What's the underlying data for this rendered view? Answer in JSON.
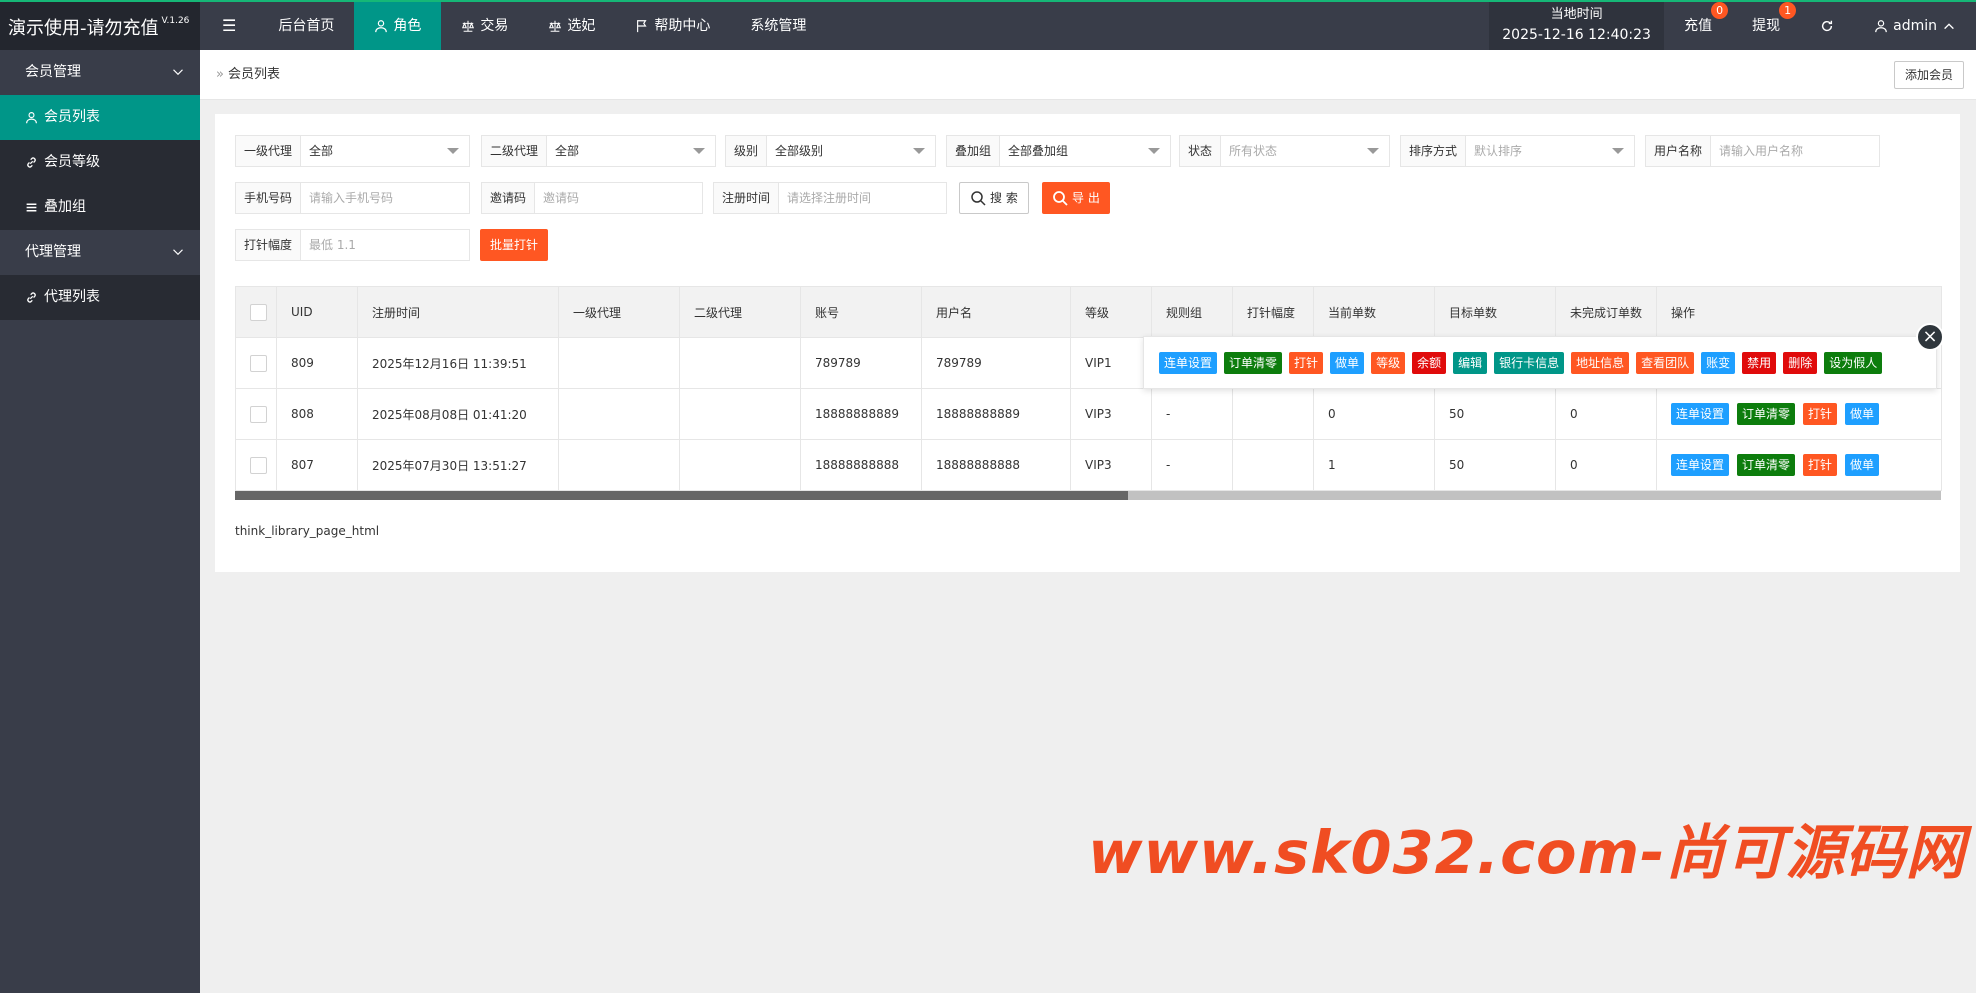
{
  "app": {
    "title": "演示使用-请勿充值",
    "version": "V.1.26"
  },
  "topnav": {
    "items": [
      {
        "label": "后台首页",
        "icon": "none"
      },
      {
        "label": "角色",
        "icon": "user-icon"
      },
      {
        "label": "交易",
        "icon": "scale-icon"
      },
      {
        "label": "选妃",
        "icon": "scale-icon"
      },
      {
        "label": "帮助中心",
        "icon": "flag-icon"
      },
      {
        "label": "系统管理",
        "icon": "none"
      }
    ],
    "active_index": 1
  },
  "header_right": {
    "clock_label": "当地时间",
    "clock_value": "2025-12-16 12:40:23",
    "recharge_label": "充值",
    "recharge_badge": "0",
    "withdraw_label": "提现",
    "withdraw_badge": "1",
    "user_label": "admin"
  },
  "sidebar": {
    "groups": [
      {
        "label": "会员管理",
        "items": [
          "会员列表",
          "会员等级",
          "叠加组"
        ]
      },
      {
        "label": "代理管理",
        "items": [
          "代理列表"
        ]
      }
    ]
  },
  "breadcrumb": {
    "current": "会员列表"
  },
  "add_button": "添加会员",
  "filters": {
    "agent1": {
      "label": "一级代理",
      "value": "全部"
    },
    "agent2": {
      "label": "二级代理",
      "value": "全部"
    },
    "level": {
      "label": "级别",
      "value": "全部级别"
    },
    "group": {
      "label": "叠加组",
      "value": "全部叠加组"
    },
    "status": {
      "label": "状态",
      "placeholder": "所有状态"
    },
    "sort": {
      "label": "排序方式",
      "placeholder": "默认排序"
    },
    "username": {
      "label": "用户名称",
      "placeholder": "请输入用户名称"
    },
    "phone": {
      "label": "手机号码",
      "placeholder": "请输入手机号码"
    },
    "invite": {
      "label": "邀请码",
      "placeholder": "邀请码"
    },
    "regtime": {
      "label": "注册时间",
      "placeholder": "请选择注册时间"
    },
    "amplitude": {
      "label": "打针幅度",
      "placeholder": "最低 1.1"
    }
  },
  "buttons": {
    "search": "搜 索",
    "export": "导 出",
    "batch": "批量打针"
  },
  "table": {
    "columns": [
      "UID",
      "注册时间",
      "一级代理",
      "二级代理",
      "账号",
      "用户名",
      "等级",
      "规则组",
      "打针幅度",
      "当前单数",
      "目标单数",
      "未完成订单数",
      "操作"
    ],
    "rows": [
      {
        "uid": "809",
        "regtime": "2025年12月16日 11:39:51",
        "agent1": "",
        "agent2": "",
        "account": "789789",
        "username": "789789",
        "level": "VIP1",
        "rule": "",
        "amp": "",
        "cur": "",
        "target": "",
        "pending": ""
      },
      {
        "uid": "808",
        "regtime": "2025年08月08日 01:41:20",
        "agent1": "",
        "agent2": "",
        "account": "18888888889",
        "username": "18888888889",
        "level": "VIP3",
        "rule": "-",
        "amp": "",
        "cur": "0",
        "target": "50",
        "pending": "0"
      },
      {
        "uid": "807",
        "regtime": "2025年07月30日 13:51:27",
        "agent1": "",
        "agent2": "",
        "account": "18888888888",
        "username": "18888888888",
        "level": "VIP3",
        "rule": "-",
        "amp": "",
        "cur": "1",
        "target": "50",
        "pending": "0"
      }
    ],
    "row_ops": [
      {
        "label": "连单设置",
        "color": "#1e9fff"
      },
      {
        "label": "订单清零",
        "color": "#0d7d0d"
      },
      {
        "label": "打针",
        "color": "#ff5722"
      },
      {
        "label": "做单",
        "color": "#1e9fff"
      }
    ]
  },
  "popup_ops": [
    {
      "label": "连单设置",
      "color": "#1e9fff"
    },
    {
      "label": "订单清零",
      "color": "#0d7d0d"
    },
    {
      "label": "打针",
      "color": "#ff5722"
    },
    {
      "label": "做单",
      "color": "#1e9fff"
    },
    {
      "label": "等级",
      "color": "#ff5722"
    },
    {
      "label": "余额",
      "color": "#e00b0b"
    },
    {
      "label": "编辑",
      "color": "#009688"
    },
    {
      "label": "银行卡信息",
      "color": "#009688"
    },
    {
      "label": "地址信息",
      "color": "#ff5722"
    },
    {
      "label": "查看团队",
      "color": "#ff5722"
    },
    {
      "label": "账变",
      "color": "#1e9fff"
    },
    {
      "label": "禁用",
      "color": "#e00b0b"
    },
    {
      "label": "删除",
      "color": "#e00b0b"
    },
    {
      "label": "设为假人",
      "color": "#0d7d0d"
    }
  ],
  "pager_text": "think_library_page_html",
  "watermark": "www.sk032.com-尚可源码网",
  "colors": {
    "accent": "#009688",
    "header": "#393d49",
    "danger": "#ff5722"
  }
}
